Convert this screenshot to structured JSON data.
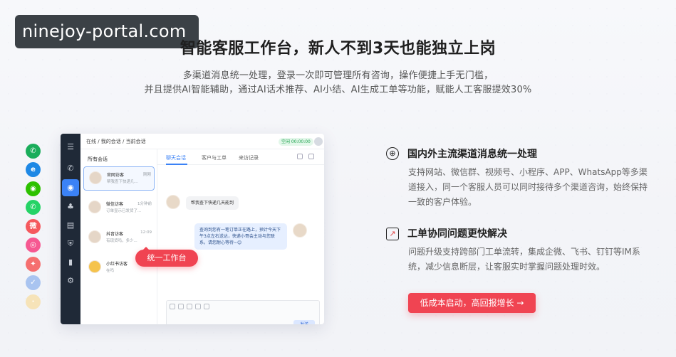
{
  "watermark": "ninejoy-portal.com",
  "hero": {
    "title": "智能客服工作台，新人不到3天也能独立上岗",
    "subtitle_line1": "多渠道消息统一处理，登录一次即可管理所有咨询，操作便捷上手无门槛，",
    "subtitle_line2": "并且提供AI智能辅助，通过AI话术推荐、AI小结、AI生成工单等功能，赋能人工客服提效30%"
  },
  "channels": [
    {
      "icon": "phone-icon",
      "glyph": "✆",
      "color": "#1aad5b"
    },
    {
      "icon": "ie-browser-icon",
      "glyph": "e",
      "color": "#1e88e5"
    },
    {
      "icon": "wechat-icon",
      "glyph": "◉",
      "color": "#2dc100"
    },
    {
      "icon": "whatsapp-icon",
      "glyph": "✆",
      "color": "#25d366"
    },
    {
      "icon": "weibo-icon",
      "glyph": "微",
      "color": "#f5595e"
    },
    {
      "icon": "instagram-icon",
      "glyph": "◎",
      "color": "#f65891"
    },
    {
      "icon": "bird-icon",
      "glyph": "✦",
      "color": "#f56f6f"
    },
    {
      "icon": "check-circle-icon",
      "glyph": "✓",
      "color": "#a9c4f0"
    },
    {
      "icon": "faded-channel-icon",
      "glyph": "·",
      "color": "#f6e3b8"
    }
  ],
  "app": {
    "breadcrumb": "在线 / 我的会话 / 当前会话",
    "status": "空闲 00:00:00",
    "list_header": "所有会话",
    "conversations": [
      {
        "name": "官网访客",
        "preview": "帮我查下快递几...",
        "time": "刚刚"
      },
      {
        "name": "微信访客",
        "preview": "订单显示已发货了...",
        "time": "1分钟前"
      },
      {
        "name": "抖音访客",
        "preview": "有现货吗，多少...",
        "time": "12:09"
      },
      {
        "name": "小红书访客",
        "preview": "在吗",
        "time": ""
      }
    ],
    "tabs": [
      "聊天会话",
      "客户与工单",
      "来访记录"
    ],
    "messages": {
      "customer": "帮我查下快递几天能到",
      "agent": "查询到您有一笔订单正在路上，预计今天下午3点左右送达，快递小哥会主动与您联系，请您耐心等待~😊"
    },
    "send_label": "发送"
  },
  "callout": "统一工作台",
  "features": [
    {
      "icon": "globe-icon",
      "title": "国内外主流渠道消息统一处理",
      "desc": "支持网站、微信群、视频号、小程序、APP、WhatsApp等多渠道接入，同一个客服人员可以同时接待多个渠道咨询，始终保持一致的客户体验。"
    },
    {
      "icon": "trend-chart-icon",
      "title": "工单协同问题更快解决",
      "desc": "问题升级支持跨部门工单流转，集成企微、飞书、钉钉等IM系统，减少信息断层，让客服实时掌握问题处理时效。"
    }
  ],
  "cta_label": "低成本启动，高回报增长 →",
  "colors": {
    "accent": "#f04452",
    "brand_blue": "#3b82f6",
    "rail": "#1f2937"
  }
}
